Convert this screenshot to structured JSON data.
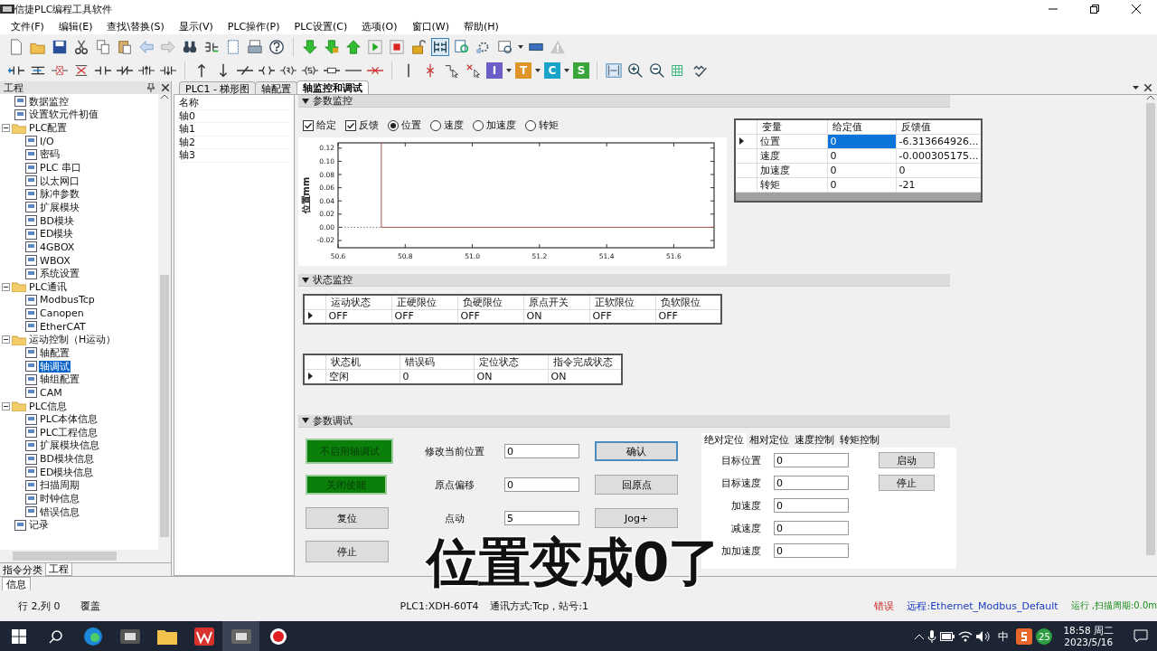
{
  "window": {
    "title": "信捷PLC编程工具软件"
  },
  "menu": [
    "文件(F)",
    "编辑(E)",
    "查找\\替换(S)",
    "显示(V)",
    "PLC操作(P)",
    "PLC设置(C)",
    "选项(O)",
    "窗口(W)",
    "帮助(H)"
  ],
  "toolbar_2": {
    "letter_buttons": [
      {
        "letter": "I",
        "color": "#6b5fc7"
      },
      {
        "letter": "T",
        "color": "#e0952a"
      },
      {
        "letter": "C",
        "color": "#1aa3c9"
      },
      {
        "letter": "S",
        "color": "#3aa53a"
      }
    ]
  },
  "project_panel": {
    "title": "工程",
    "tree": [
      {
        "label": "数据监控",
        "selected": false
      },
      {
        "label": "设置软元件初值",
        "selected": false
      },
      {
        "label": "PLC配置",
        "selected": false,
        "expanded": true,
        "children": [
          {
            "label": "I/O",
            "selected": false
          },
          {
            "label": "密码",
            "selected": false
          },
          {
            "label": "PLC 串口",
            "selected": false
          },
          {
            "label": "以太网口",
            "selected": false
          },
          {
            "label": "脉冲参数",
            "selected": false
          },
          {
            "label": "扩展模块",
            "selected": false
          },
          {
            "label": "BD模块",
            "selected": false
          },
          {
            "label": "ED模块",
            "selected": false
          },
          {
            "label": "4GBOX",
            "selected": false
          },
          {
            "label": "WBOX",
            "selected": false
          },
          {
            "label": "系统设置",
            "selected": false
          }
        ]
      },
      {
        "label": "PLC通讯",
        "selected": false,
        "expanded": true,
        "children": [
          {
            "label": "ModbusTcp",
            "selected": false
          },
          {
            "label": "Canopen",
            "selected": false
          },
          {
            "label": "EtherCAT",
            "selected": false
          }
        ]
      },
      {
        "label": "运动控制（H运动）",
        "selected": false,
        "expanded": true,
        "children": [
          {
            "label": "轴配置",
            "selected": false
          },
          {
            "label": "轴调试",
            "selected": true
          },
          {
            "label": "轴组配置",
            "selected": false
          },
          {
            "label": "CAM",
            "selected": false
          }
        ]
      },
      {
        "label": "PLC信息",
        "selected": false,
        "expanded": true,
        "children": [
          {
            "label": "PLC本体信息",
            "selected": false
          },
          {
            "label": "PLC工程信息",
            "selected": false
          },
          {
            "label": "扩展模块信息",
            "selected": false
          },
          {
            "label": "BD模块信息",
            "selected": false
          },
          {
            "label": "ED模块信息",
            "selected": false
          },
          {
            "label": "扫描周期",
            "selected": false
          },
          {
            "label": "时钟信息",
            "selected": false
          },
          {
            "label": "错误信息",
            "selected": false
          }
        ]
      },
      {
        "label": "记录",
        "selected": false
      }
    ],
    "tabs": [
      {
        "label": "指令分类",
        "selected": false
      },
      {
        "label": "工程",
        "selected": true
      }
    ]
  },
  "info_tab": {
    "label": "信息"
  },
  "document_tabs": [
    {
      "label": "PLC1 - 梯形图",
      "selected": false
    },
    {
      "label": "轴配置",
      "selected": false
    },
    {
      "label": "轴监控和调试",
      "selected": true
    }
  ],
  "axis_list": {
    "header": "名称",
    "items": [
      "轴0",
      "轴1",
      "轴2",
      "轴3"
    ]
  },
  "param_monitor": {
    "title": "参数监控",
    "checkboxes": [
      {
        "label": "给定",
        "checked": true
      },
      {
        "label": "反馈",
        "checked": true
      }
    ],
    "radios": [
      {
        "label": "位置",
        "selected": true
      },
      {
        "label": "速度",
        "selected": false
      },
      {
        "label": "加速度",
        "selected": false
      },
      {
        "label": "转矩",
        "selected": false
      }
    ],
    "chart_data": {
      "type": "line",
      "ylabel": "位置mm",
      "x": [
        50.6,
        50.729,
        50.729,
        51.72
      ],
      "series": [
        {
          "color": "#777777",
          "line_style": "dotted",
          "values": [
            0,
            0,
            null,
            null
          ]
        },
        {
          "color": "#a0524d",
          "line_style": "solid",
          "values": [
            null,
            0.128,
            0,
            0
          ]
        }
      ],
      "xlim": [
        50.6,
        51.72
      ],
      "ylim": [
        -0.031,
        0.128
      ],
      "xticks": [
        {
          "value": 50.6,
          "label": "50.6"
        },
        {
          "value": 50.8,
          "label": "50.8"
        },
        {
          "value": 51.0,
          "label": "51.0"
        },
        {
          "value": 51.2,
          "label": "51.2"
        },
        {
          "value": 51.4,
          "label": "51.4"
        },
        {
          "value": 51.6,
          "label": "51.6"
        }
      ],
      "yticks": [
        {
          "value": -0.02,
          "label": "-0.02"
        },
        {
          "value": 0,
          "label": "0.00"
        },
        {
          "value": 0.02,
          "label": "0.02"
        },
        {
          "value": 0.04,
          "label": "0.04"
        },
        {
          "value": 0.06,
          "label": "0.06"
        },
        {
          "value": 0.08,
          "label": "0.08"
        },
        {
          "value": 0.1,
          "label": "0.10"
        },
        {
          "value": 0.12,
          "label": "0.12"
        }
      ]
    },
    "table": {
      "columns": [
        "变量",
        "给定值",
        "反馈值"
      ],
      "rows": [
        {
          "cells": [
            "位置",
            "0",
            "-6.313664926..."
          ],
          "selected": true
        },
        {
          "cells": [
            "速度",
            "0",
            "-0.000305175..."
          ],
          "selected": false
        },
        {
          "cells": [
            "加速度",
            "0",
            "0"
          ],
          "selected": false
        },
        {
          "cells": [
            "转矩",
            "0",
            "-21"
          ],
          "selected": false
        }
      ]
    }
  },
  "status_monitor": {
    "title": "状态监控",
    "tables": [
      {
        "columns": [
          "运动状态",
          "正硬限位",
          "负硬限位",
          "原点开关",
          "正软限位",
          "负软限位"
        ],
        "rows": [
          {
            "cells": [
              "OFF",
              "OFF",
              "OFF",
              "ON",
              "OFF",
              "OFF"
            ],
            "selected": true
          }
        ]
      },
      {
        "columns": [
          "状态机",
          "错误码",
          "定位状态",
          "指令完成状态"
        ],
        "rows": [
          {
            "cells": [
              "空闲",
              "0",
              "ON",
              "ON"
            ],
            "selected": true
          }
        ]
      }
    ]
  },
  "param_debug": {
    "title": "参数调试",
    "mode_buttons": [
      {
        "label": "不启用轴调试",
        "active": true
      },
      {
        "label": "关闭使能",
        "active": true
      },
      {
        "label": "复位",
        "active": false
      },
      {
        "label": "停止",
        "active": false
      }
    ],
    "fields": [
      {
        "label": "修改当前位置",
        "value": "0"
      },
      {
        "label": "原点偏移",
        "value": "0"
      },
      {
        "label": "点动",
        "value": "5"
      }
    ],
    "action_buttons": [
      {
        "label": "确认",
        "focused": true
      },
      {
        "label": "回原点",
        "focused": false
      },
      {
        "label": "Jog+",
        "focused": false
      }
    ],
    "motion_tabs": [
      {
        "label": "绝对定位",
        "selected": true
      },
      {
        "label": "相对定位",
        "selected": false
      },
      {
        "label": "速度控制",
        "selected": false
      },
      {
        "label": "转矩控制",
        "selected": false
      }
    ],
    "motion_fields": [
      {
        "label": "目标位置",
        "value": "0"
      },
      {
        "label": "目标速度",
        "value": "0"
      },
      {
        "label": "加速度",
        "value": "0"
      },
      {
        "label": "减速度",
        "value": "0"
      },
      {
        "label": "加加速度",
        "value": "0"
      }
    ],
    "motion_buttons": [
      "启动",
      "停止"
    ]
  },
  "caption": "位置变成0了",
  "status_bar": {
    "position": "行 2,列 0",
    "mode": "覆盖",
    "plc": "PLC1:XDH-60T4",
    "comm": "通讯方式:Tcp，站号:1",
    "error": "错误",
    "remote": "远程:Ethernet_Modbus_Default",
    "run": "运行 ,扫描周期:0.0m"
  },
  "taskbar": {
    "ime": "中",
    "badge": "25",
    "time": "18:58 周二",
    "date": "2023/5/16"
  }
}
